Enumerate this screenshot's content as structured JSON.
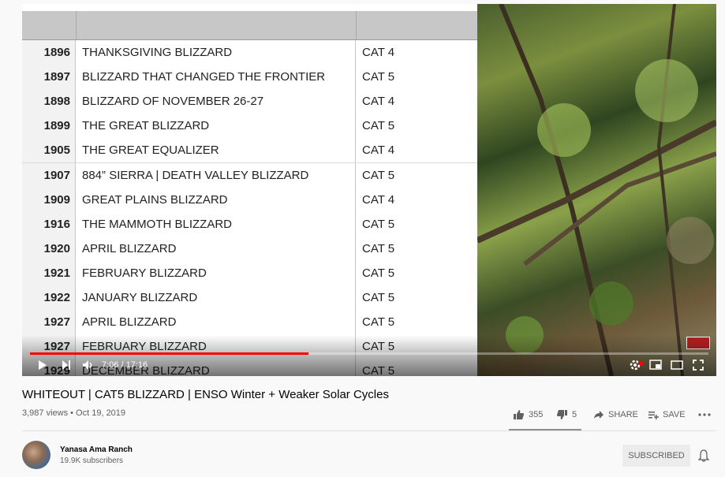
{
  "video": {
    "table": {
      "rows": [
        {
          "year": "1896",
          "name": "THANKSGIVING BLIZZARD",
          "cat": "CAT 4"
        },
        {
          "year": "1897",
          "name": "BLIZZARD THAT CHANGED THE  FRONTIER",
          "cat": "CAT 5"
        },
        {
          "year": "1898",
          "name": "BLIZZARD OF NOVEMBER 26-27",
          "cat": "CAT 4"
        },
        {
          "year": "1899",
          "name": "THE GREAT BLIZZARD",
          "cat": "CAT 5"
        },
        {
          "year": "1905",
          "name": "THE GREAT EQUALIZER",
          "cat": "CAT 4"
        },
        {
          "year": "1907",
          "name": "884” SIERRA | DEATH VALLEY BLIZZARD",
          "cat": "CAT 5"
        },
        {
          "year": "1909",
          "name": "GREAT PLAINS BLIZZARD",
          "cat": "CAT 4"
        },
        {
          "year": "1916",
          "name": "THE MAMMOTH BLIZZARD",
          "cat": "CAT 5"
        },
        {
          "year": "1920",
          "name": "APRIL BLIZZARD",
          "cat": "CAT 5"
        },
        {
          "year": "1921",
          "name": "FEBRUARY BLIZZARD",
          "cat": "CAT 5"
        },
        {
          "year": "1922",
          "name": "JANUARY BLIZZARD",
          "cat": "CAT 5"
        },
        {
          "year": "1927",
          "name": "APRIL BLIZZARD",
          "cat": "CAT 5"
        },
        {
          "year": "1927",
          "name": "FEBRUARY BLIZZARD",
          "cat": "CAT 5"
        },
        {
          "year": "1929",
          "name": "DECEMBER BLIZZARD",
          "cat": "CAT 5"
        }
      ]
    },
    "controls": {
      "time": "7:06 / 17:16",
      "progress": 0.41,
      "buffered": 0.41
    }
  },
  "info": {
    "title": "WHITEOUT | CAT5 BLIZZARD | ENSO Winter + Weaker Solar Cycles",
    "meta": "3,987 views • Oct 19, 2019",
    "likes": "355",
    "dislikes": "5",
    "share_label": "SHARE",
    "save_label": "SAVE",
    "like_ratio": 0.986
  },
  "channel": {
    "name": "Yanasa Ama Ranch",
    "subscribers": "19.9K subscribers",
    "subscribe_label": "SUBSCRIBED"
  },
  "colors": {
    "progress": "#ff0000",
    "accent_text": "#606060"
  }
}
